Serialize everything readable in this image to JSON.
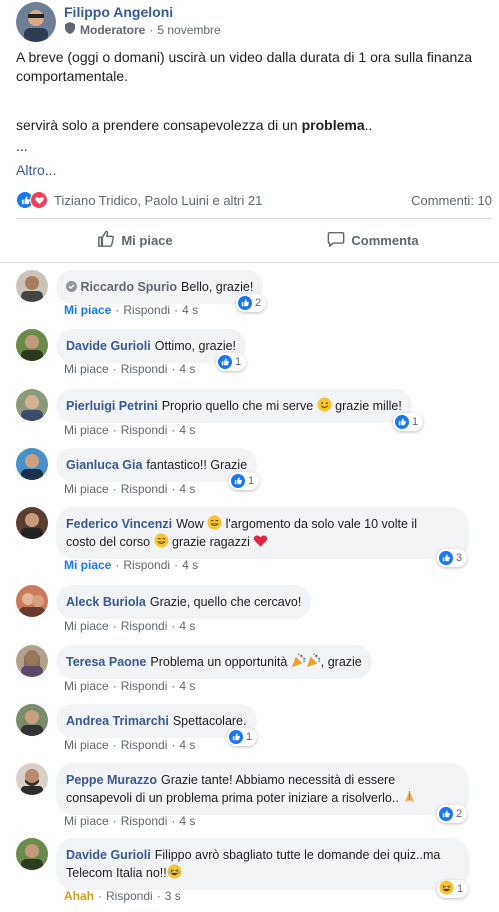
{
  "post": {
    "author": "Filippo Angeloni",
    "role": "Moderatore",
    "separator": "·",
    "date": "5 novembre",
    "paragraph1": "A breve (oggi o domani) uscirà un video dalla durata di 1 ora sulla finanza comportamentale.",
    "paragraph2_start": "servirà solo a prendere consapevolezza di un ",
    "paragraph2_bold": "problema",
    "paragraph2_end": "..",
    "ellipsis": "...",
    "more": "Altro...",
    "reaction_names": "Tiziano Tridico, Paolo Luini e altri 21",
    "comments_count": "Commenti: 10",
    "like_label": "Mi piace",
    "comment_label": "Commenta"
  },
  "comments": [
    {
      "author": "Riccardo Spurio",
      "text": "Bello, grazie!",
      "like": "Mi piace",
      "reply": "Rispondi",
      "time": "4 s",
      "reactions": "2"
    },
    {
      "author": "Davide Gurioli",
      "text": "Ottimo, grazie!",
      "like": "Mi piace",
      "reply": "Rispondi",
      "time": "4 s",
      "reactions": "1"
    },
    {
      "author": "Pierluigi Petrini",
      "text": "Proprio quello che mi serve",
      "text2": "grazie mille!",
      "like": "Mi piace",
      "reply": "Rispondi",
      "time": "4 s",
      "reactions": "1"
    },
    {
      "author": "Gianluca Gia",
      "text": "fantastico!! Grazie",
      "like": "Mi piace",
      "reply": "Rispondi",
      "time": "4 s",
      "reactions": "1"
    },
    {
      "author": "Federico Vincenzi",
      "text": "Wow",
      "text2": "l'argomento da solo vale 10 volte il",
      "text3": "costo del corso",
      "text4": "grazie ragazzi",
      "like": "Mi piace",
      "reply": "Rispondi",
      "time": "4 s",
      "reactions": "3"
    },
    {
      "author": "Aleck Buriola",
      "text": "Grazie, quello che cercavo!",
      "like": "Mi piace",
      "reply": "Rispondi",
      "time": "4 s"
    },
    {
      "author": "Teresa Paone",
      "text": "Problema un opportunità",
      "text2": ", grazie",
      "like": "Mi piace",
      "reply": "Rispondi",
      "time": "4 s"
    },
    {
      "author": "Andrea Trimarchi",
      "text": "Spettacolare.",
      "like": "Mi piace",
      "reply": "Rispondi",
      "time": "4 s",
      "reactions": "1"
    },
    {
      "author": "Peppe Murazzo",
      "text": "Grazie tante! Abbiamo necessità di essere",
      "text2": "consapevoli di un problema prima poter iniziare a risolverlo..",
      "like": "Mi piace",
      "reply": "Rispondi",
      "time": "4 s",
      "reactions": "2"
    },
    {
      "author": "Davide Gurioli",
      "text": "Filippo avrò sbagliato tutte le domande dei quiz..ma",
      "text2": "Telecom Italia no!!",
      "like": "Ahah",
      "reply": "Rispondi",
      "time": "3 s",
      "reactions": "1"
    }
  ],
  "dot": "·",
  "colors": {
    "link": "#385898",
    "like_blue": "#1877f2",
    "love_red": "#f33e58",
    "bubble": "#f2f3f5",
    "meta_gray": "#606770"
  }
}
